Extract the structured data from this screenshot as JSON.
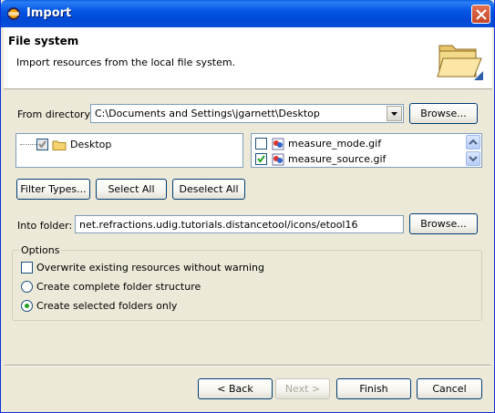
{
  "window": {
    "title": "Import"
  },
  "header": {
    "title": "File system",
    "description": "Import resources from the local file system."
  },
  "from_directory": {
    "label": "From directory:",
    "value": "C:\\Documents and Settings\\jgarnett\\Desktop",
    "browse_label": "Browse..."
  },
  "tree": {
    "items": [
      {
        "label": "Desktop",
        "checked": "partial"
      }
    ]
  },
  "files": {
    "items": [
      {
        "label": "measure_mode.gif",
        "checked": false
      },
      {
        "label": "measure_source.gif",
        "checked": true
      }
    ]
  },
  "selection_buttons": {
    "filter_types": "Filter Types...",
    "select_all": "Select All",
    "deselect_all": "Deselect All"
  },
  "into_folder": {
    "label": "Into folder:",
    "value": "net.refractions.udig.tutorials.distancetool/icons/etool16",
    "browse_label": "Browse..."
  },
  "options": {
    "legend": "Options",
    "overwrite_label": "Overwrite existing resources without warning",
    "overwrite_checked": false,
    "create_structure_label": "Create complete folder structure",
    "create_selected_label": "Create selected folders only",
    "selected_option": "create_selected"
  },
  "footer": {
    "back_label": "< Back",
    "next_label": "Next >",
    "finish_label": "Finish",
    "cancel_label": "Cancel"
  },
  "colors": {
    "titlebar": "#0054e3",
    "window_bg": "#ece9d8",
    "field_border": "#7f9db9",
    "button_border": "#003c74"
  }
}
